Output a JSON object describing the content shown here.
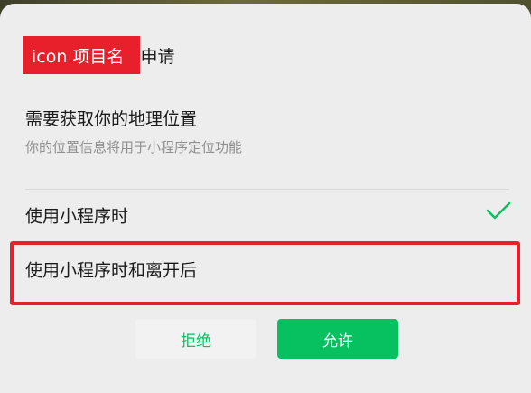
{
  "header": {
    "app_icon_text": "icon 项目名",
    "apply_label": "申请"
  },
  "permission": {
    "title": "需要获取你的地理位置",
    "description": "你的位置信息将用于小程序定位功能"
  },
  "options": [
    {
      "label": "使用小程序时",
      "selected": true
    },
    {
      "label": "使用小程序时和离开后",
      "selected": false
    }
  ],
  "buttons": {
    "reject_label": "拒绝",
    "allow_label": "允许"
  },
  "colors": {
    "accent_green": "#07c160",
    "highlight_red": "#e8202b"
  },
  "icons": {
    "selected": "check-icon"
  }
}
